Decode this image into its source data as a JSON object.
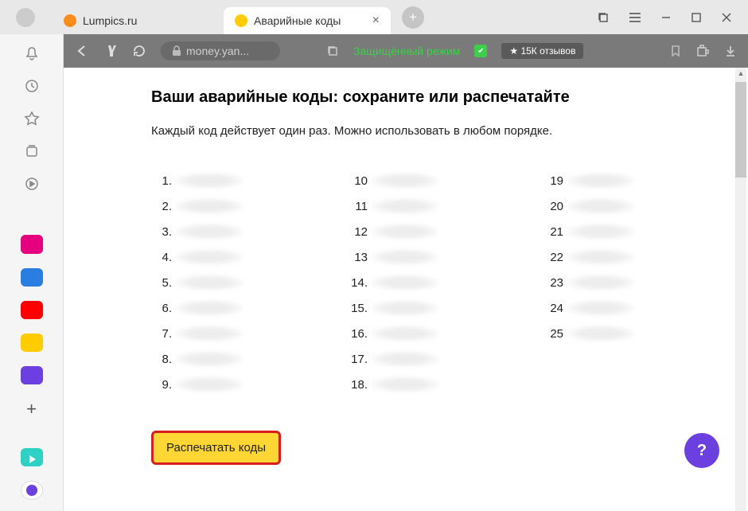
{
  "titlebar": {
    "tab_inactive": {
      "label": "Lumpics.ru",
      "favicon_color": "#ff8c1a"
    },
    "tab_active": {
      "label": "Аварийные коды",
      "favicon_color": "#ffcc00"
    }
  },
  "toolbar": {
    "url": "money.yan...",
    "protected_label": "Защищённый режим",
    "reviews_label": "★ 15К отзывов"
  },
  "sidebar": {
    "apps": [
      {
        "name": "ivi",
        "color": "#e6007e"
      },
      {
        "name": "docs",
        "color": "#2a7de1"
      },
      {
        "name": "youtube",
        "color": "#ff0000"
      },
      {
        "name": "mail",
        "color": "#ffcc00"
      },
      {
        "name": "app-purple",
        "color": "#6b3fe0"
      }
    ]
  },
  "content": {
    "heading": "Ваши аварийные коды: сохраните или распечатайте",
    "subtext": "Каждый код действует один раз. Можно использовать в любом порядке.",
    "columns": [
      [
        "1.",
        "2.",
        "3.",
        "4.",
        "5.",
        "6.",
        "7.",
        "8.",
        "9."
      ],
      [
        "10",
        "11",
        "12",
        "13",
        "14.",
        "15.",
        "16.",
        "17.",
        "18."
      ],
      [
        "19",
        "20",
        "21",
        "22",
        "23",
        "24",
        "25"
      ]
    ],
    "print_label": "Распечатать коды"
  },
  "fab": {
    "label": "?"
  }
}
